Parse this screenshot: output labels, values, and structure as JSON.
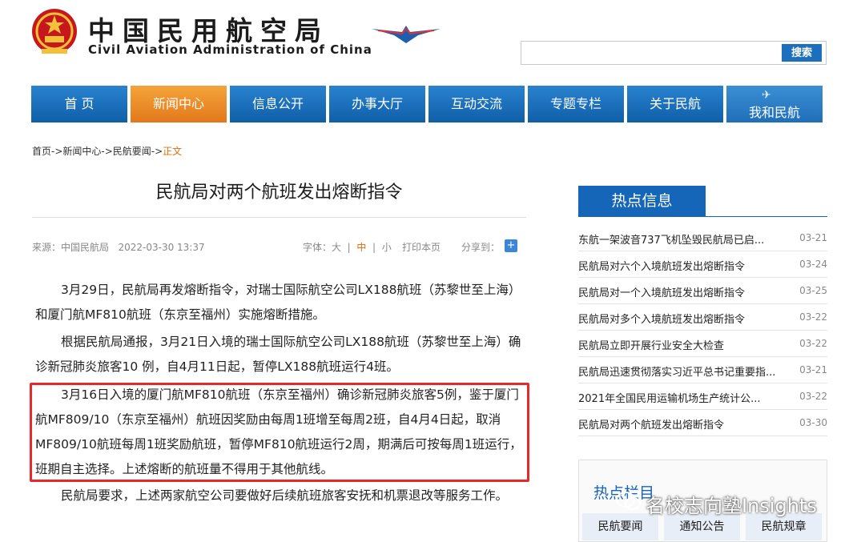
{
  "header": {
    "title_cn": "中国民用航空局",
    "title_en": "Civil Aviation Administration of China",
    "search_button": "搜索"
  },
  "nav": {
    "items": [
      "首 页",
      "新闻中心",
      "信息公开",
      "办事大厅",
      "互动交流",
      "专题专栏",
      "关于民航",
      "我和民航"
    ],
    "active_index": 1,
    "active_color": "#e3781b",
    "primary_color": "#1565b8"
  },
  "breadcrumb": {
    "path": "首页->新闻中心->民航要闻->",
    "current": "正文"
  },
  "article": {
    "title": "民航局对两个航班发出熔断指令",
    "source": "来源：中国民航局",
    "datetime": "2022-03-30 13:37",
    "font_label": "字体：",
    "font_large": "大",
    "font_medium": "中",
    "font_small": "小",
    "sep": "|",
    "print": "打印本页",
    "share": "分享到：",
    "paragraphs": [
      "3月29日，民航局再发熔断指令，对瑞士国际航空公司LX188航班（苏黎世至上海）和厦门航MF810航班（东京至福州）实施熔断措施。",
      "根据民航局通报，3月21日入境的瑞士国际航空公司LX188航班（苏黎世至上海）确诊新冠肺炎旅客10 例，自4月11日起，暂停LX188航班运行4班。",
      "3月16日入境的厦门航MF810航班（东京至福州）确诊新冠肺炎旅客5例，鉴于厦门航MF809/10（东京至福州）航班因奖励由每周1班增至每周2班，自4月4日起，取消MF809/10航班每周1班奖励航班，暂停MF810航班运行2周，期满后可按每周1班运行，班期自主选择。上述熔断的航班量不得用于其他航线。",
      "民航局要求，上述两家航空公司要做好后续航班旅客安抚和机票退改等服务工作。"
    ]
  },
  "hot": {
    "title": "热点信息",
    "items": [
      {
        "title": "东航一架波音737飞机坠毁民航局已启...",
        "date": "03-21"
      },
      {
        "title": "民航局对六个入境航班发出熔断指令",
        "date": "03-24"
      },
      {
        "title": "民航局对一个入境航班发出熔断指令",
        "date": "03-25"
      },
      {
        "title": "民航局对多个入境航班发出熔断指令",
        "date": "03-22"
      },
      {
        "title": "民航局立即开展行业安全大检查",
        "date": "03-22"
      },
      {
        "title": "民航局迅速贯彻落实习近平总书记重要指...",
        "date": "03-21"
      },
      {
        "title": "2021年全国民用运输机场生产统计公...",
        "date": "03-22"
      },
      {
        "title": "民航局对两个航班发出熔断指令",
        "date": "03-30"
      }
    ]
  },
  "topics": {
    "title": "热点栏目",
    "buttons": [
      "民航要闻",
      "通知公告",
      "民航规章"
    ]
  },
  "watermark": {
    "text": "名校志向塾Insights"
  }
}
